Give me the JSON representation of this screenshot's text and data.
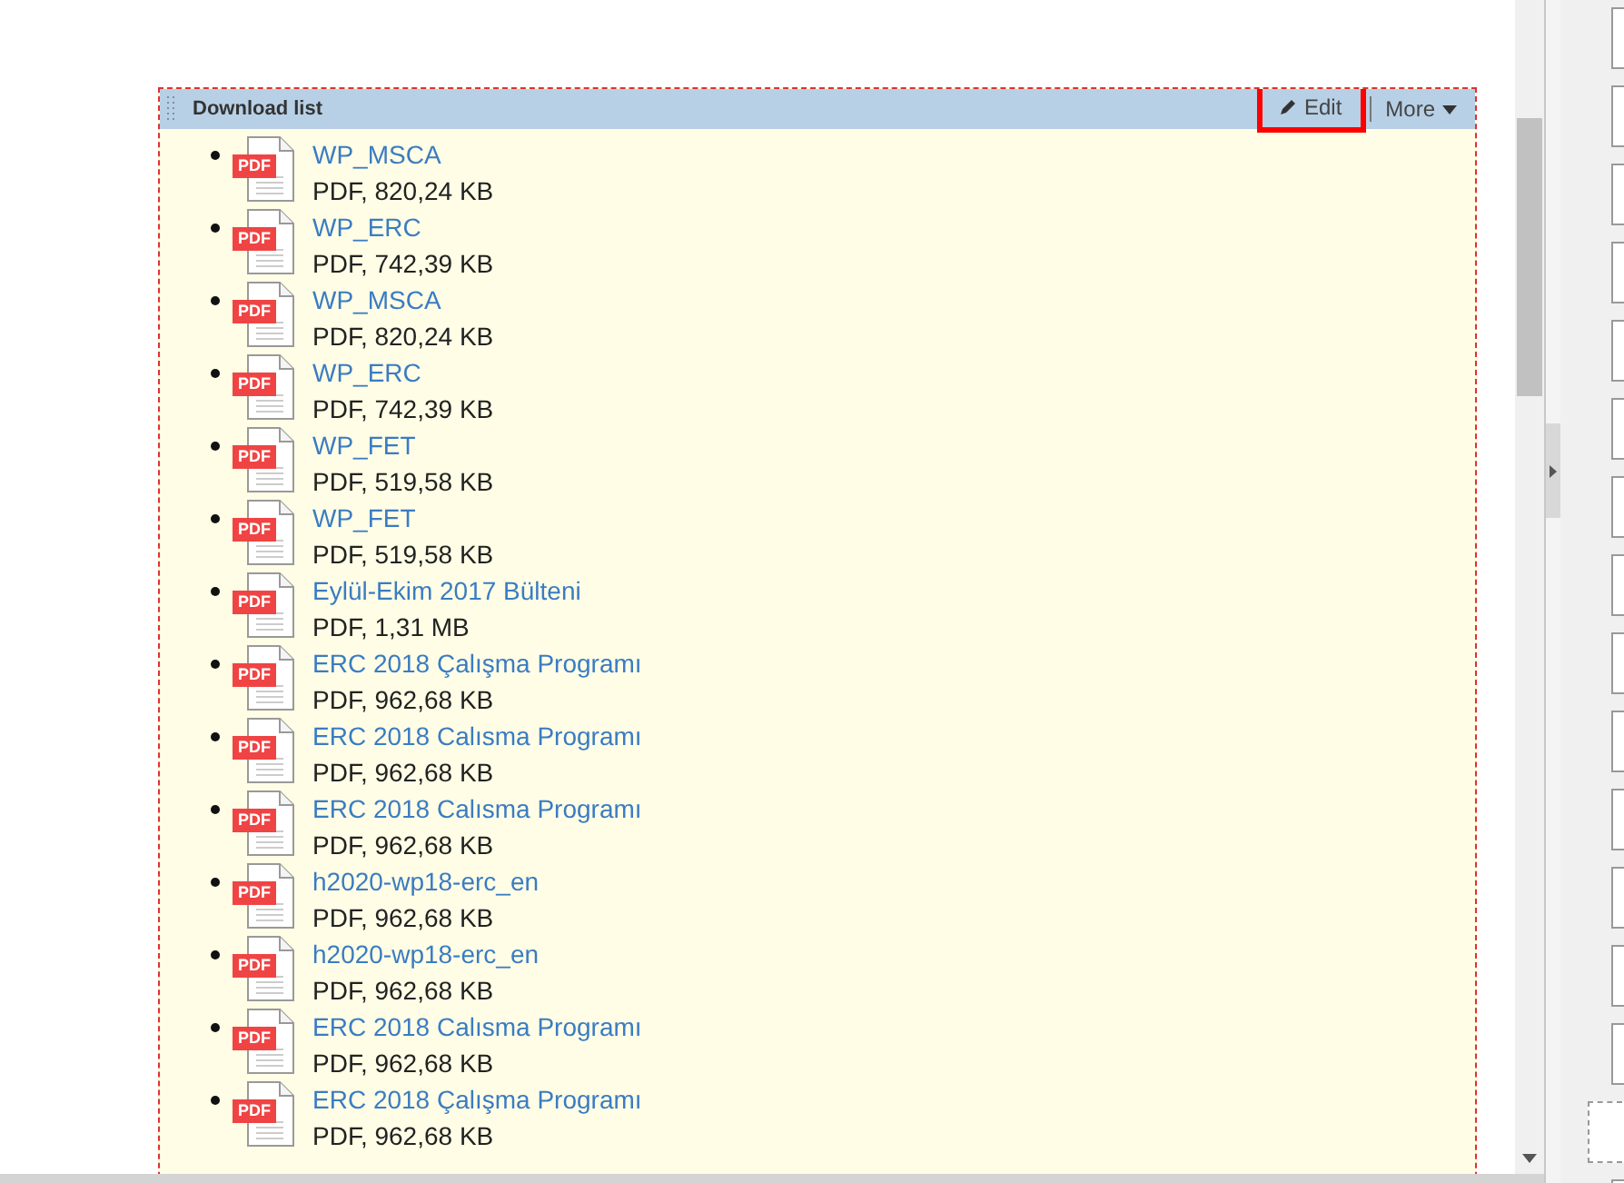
{
  "panel": {
    "title": "Download list",
    "actions": [
      {
        "label": "Edit",
        "kind": "edit",
        "highlighted": true
      },
      {
        "label": "More",
        "kind": "menu",
        "highlighted": false
      }
    ]
  },
  "files": [
    {
      "badge": "PDF",
      "name": "WP_MSCA",
      "info": "PDF, 820,24 KB"
    },
    {
      "badge": "PDF",
      "name": "WP_ERC",
      "info": "PDF, 742,39 KB"
    },
    {
      "badge": "PDF",
      "name": "WP_MSCA",
      "info": "PDF, 820,24 KB"
    },
    {
      "badge": "PDF",
      "name": "WP_ERC",
      "info": "PDF, 742,39 KB"
    },
    {
      "badge": "PDF",
      "name": "WP_FET",
      "info": "PDF, 519,58 KB"
    },
    {
      "badge": "PDF",
      "name": "WP_FET",
      "info": "PDF, 519,58 KB"
    },
    {
      "badge": "PDF",
      "name": "Eylül-Ekim 2017 Bülteni",
      "info": "PDF, 1,31 MB"
    },
    {
      "badge": "PDF",
      "name": "ERC 2018 Çalışma Programı",
      "info": "PDF, 962,68 KB"
    },
    {
      "badge": "PDF",
      "name": "ERC 2018 Calısma Programı",
      "info": "PDF, 962,68 KB"
    },
    {
      "badge": "PDF",
      "name": "ERC 2018 Calısma Programı",
      "info": "PDF, 962,68 KB"
    },
    {
      "badge": "PDF",
      "name": "h2020-wp18-erc_en",
      "info": "PDF, 962,68 KB"
    },
    {
      "badge": "PDF",
      "name": "h2020-wp18-erc_en",
      "info": "PDF, 962,68 KB"
    },
    {
      "badge": "PDF",
      "name": "ERC 2018 Calısma Programı",
      "info": "PDF, 962,68 KB"
    },
    {
      "badge": "PDF",
      "name": "ERC 2018 Çalışma Programı",
      "info": "PDF, 962,68 KB"
    }
  ]
}
